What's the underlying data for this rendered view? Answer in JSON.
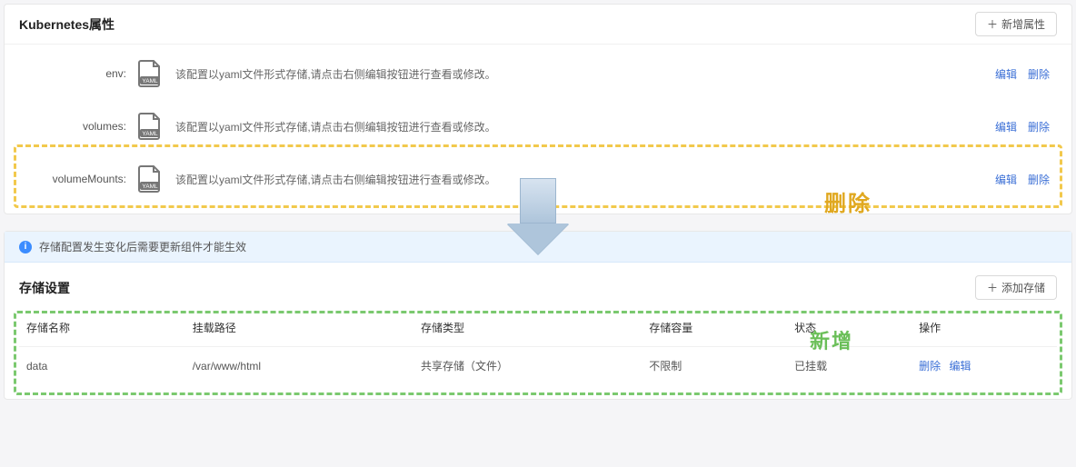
{
  "k8s": {
    "title": "Kubernetes属性",
    "add_btn": "新增属性",
    "desc": "该配置以yaml文件形式存储,请点击右侧编辑按钮进行查看或修改。",
    "items": [
      {
        "label": "env:"
      },
      {
        "label": "volumes:"
      },
      {
        "label": "volumeMounts:"
      }
    ],
    "edit": "编辑",
    "delete": "删除",
    "annotation_delete": "删除"
  },
  "arrow_note": "",
  "storage": {
    "alert": "存储配置发生变化后需要更新组件才能生效",
    "title": "存储设置",
    "add_btn": "添加存储",
    "columns": {
      "name": "存储名称",
      "path": "挂载路径",
      "type": "存储类型",
      "capacity": "存储容量",
      "status": "状态",
      "actions": "操作"
    },
    "row": {
      "name": "data",
      "path": "/var/www/html",
      "type": "共享存储（文件）",
      "capacity": "不限制",
      "status": "已挂载",
      "delete": "删除",
      "edit": "编辑"
    },
    "annotation_add": "新增"
  }
}
